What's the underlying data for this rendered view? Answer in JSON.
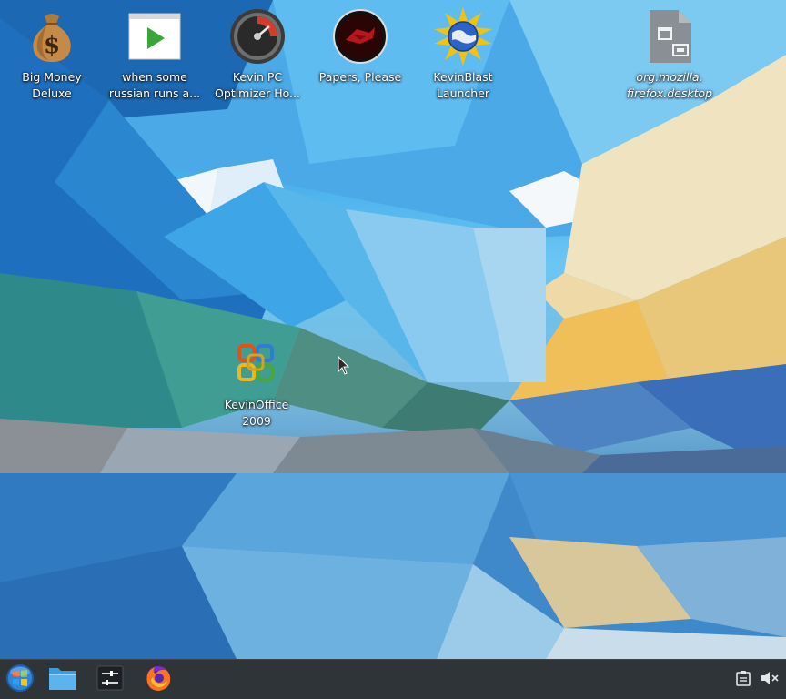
{
  "desktop": {
    "icons": [
      {
        "id": "big-money-deluxe",
        "label": "Big Money\nDeluxe",
        "icon": "money-bag-icon"
      },
      {
        "id": "russian-video",
        "label": "when some\nrussian runs a...",
        "icon": "video-play-icon"
      },
      {
        "id": "kevin-pc-optimizer",
        "label": "Kevin PC\nOptimizer Ho...",
        "icon": "speedometer-icon"
      },
      {
        "id": "papers-please",
        "label": "Papers, Please",
        "icon": "papers-please-icon"
      },
      {
        "id": "kevinblast-launcher",
        "label": "KevinBlast\nLauncher",
        "icon": "globe-sun-icon"
      },
      {
        "id": "firefox-desktop-file",
        "label": "org.mozilla.\nfirefox.desktop",
        "icon": "desktop-file-icon"
      },
      {
        "id": "kevinoffice-2009",
        "label": "KevinOffice\n2009",
        "icon": "office-icon"
      }
    ]
  },
  "taskbar": {
    "start": {
      "icon": "start-orb-icon"
    },
    "pinned": [
      {
        "id": "file-manager",
        "icon": "folder-icon"
      },
      {
        "id": "system-settings",
        "icon": "settings-sliders-icon"
      },
      {
        "id": "firefox",
        "icon": "firefox-icon"
      }
    ],
    "tray": [
      {
        "id": "clipboard",
        "icon": "clipboard-icon"
      },
      {
        "id": "volume",
        "icon": "speaker-muted-icon"
      }
    ]
  },
  "colors": {
    "taskbar_bg": "#2f3438",
    "label_text": "#ffffff"
  }
}
